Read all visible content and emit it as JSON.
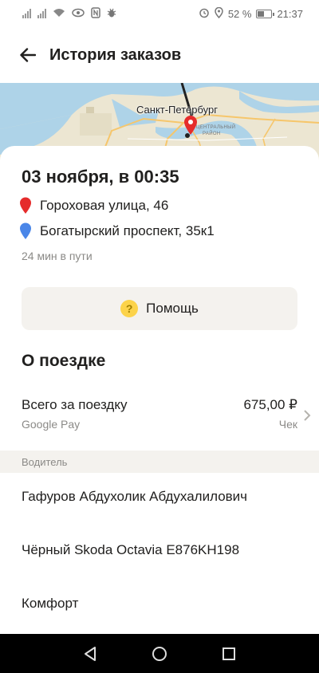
{
  "status_bar": {
    "battery_percent": 52,
    "battery_text": "52 %",
    "time": "21:37",
    "icons": [
      "signal-icon",
      "signal-icon",
      "wifi-icon",
      "eye-icon",
      "nfc-icon",
      "bug-icon",
      "alarm-icon",
      "location-icon",
      "battery-icon"
    ]
  },
  "header": {
    "title": "История заказов",
    "back_icon": "arrow-left-icon"
  },
  "map": {
    "city_label": "Санкт-Петербург",
    "district_label_line1": "ЦЕНТРАЛЬНЫЙ",
    "district_label_line2": "РАЙОН"
  },
  "order": {
    "date": "03 ноября, в 00:35",
    "from_address": "Гороховая улица, 46",
    "to_address": "Богатырский проспект, 35к1",
    "duration": "24 мин в пути"
  },
  "help_button": {
    "label": "Помощь",
    "icon_glyph": "?"
  },
  "trip": {
    "section_title": "О поездке",
    "total_label": "Всего за поездку",
    "payment_method": "Google Pay",
    "total_value": "675,00 ₽",
    "receipt_label": "Чек"
  },
  "driver": {
    "section_label": "Водитель",
    "name": "Гафуров Абдухолик Абдухалилович",
    "car": "Чёрный Skoda Octavia E876KH198",
    "tariff": "Комфорт"
  },
  "colors": {
    "accent_yellow": "#fcd34a",
    "pin_red": "#e52b2b",
    "pin_blue": "#4a86e8",
    "muted_text": "#8b8a87",
    "surface_gray": "#f4f2ee"
  }
}
